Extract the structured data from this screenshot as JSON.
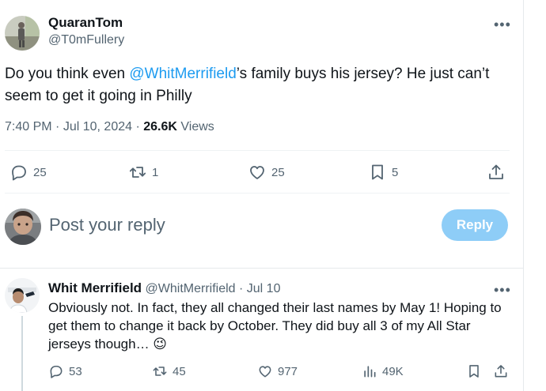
{
  "tweet": {
    "author_name": "QuaranTom",
    "author_handle": "@T0mFullery",
    "text_before": "Do you think even ",
    "mention": "@WhitMerrifield",
    "text_after": "’s family buys his jersey? He just can’t seem to get it going in Philly",
    "time": "7:40 PM",
    "date": "Jul 10, 2024",
    "views_count": "26.6K",
    "views_label": "Views",
    "replies": "25",
    "reposts": "1",
    "likes": "25",
    "bookmarks": "5"
  },
  "composer": {
    "placeholder": "Post your reply",
    "reply_button": "Reply"
  },
  "reply": {
    "author_name": "Whit Merrifield",
    "author_handle": "@WhitMerrifield",
    "date": "Jul 10",
    "text": "Obviously not. In fact, they all changed their last names by May 1! Hoping to get them to change it back by October. They did buy all 3 of my All Star jerseys though… 😉",
    "replies": "53",
    "reposts": "45",
    "likes": "977",
    "views": "49K"
  },
  "colors": {
    "accent": "#1d9bf0",
    "reply_button_bg": "#8ecdf7",
    "secondary_text": "#536471"
  },
  "icons": [
    "more-icon",
    "reply-icon",
    "repost-icon",
    "like-icon",
    "bookmark-icon",
    "share-icon",
    "views-icon"
  ]
}
